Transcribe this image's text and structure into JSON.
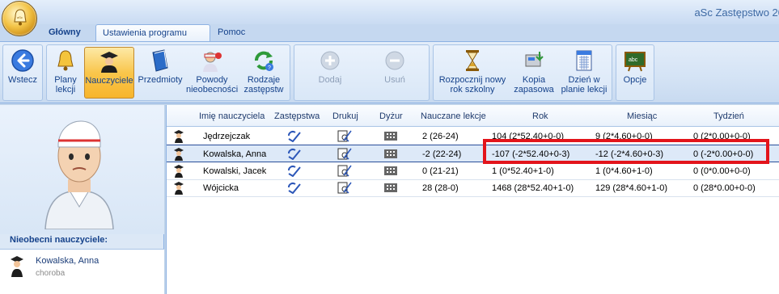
{
  "app": {
    "title": "aSc Zastępstwo 20"
  },
  "tabs": [
    {
      "label": "Główny",
      "active": false
    },
    {
      "label": "Ustawienia programu",
      "active": true
    },
    {
      "label": "Pomoc",
      "active": false
    }
  ],
  "ribbon": {
    "back": {
      "label": "Wstecz",
      "icon": "back-arrow-icon"
    },
    "group1": [
      {
        "label": "Plany\nlekcji",
        "icon": "bell-icon"
      },
      {
        "label": "Nauczyciele",
        "icon": "teacher-icon",
        "selected": true
      },
      {
        "label": "Przedmioty",
        "icon": "book-icon"
      },
      {
        "label": "Powody\nnieobecności",
        "icon": "absence-reason-icon"
      },
      {
        "label": "Rodzaje\nzastępstw",
        "icon": "substitution-types-icon"
      }
    ],
    "group2": [
      {
        "label": "Dodaj",
        "icon": "add-icon",
        "disabled": true
      },
      {
        "label": "Usuń",
        "icon": "remove-icon",
        "disabled": true
      }
    ],
    "group3": [
      {
        "label": "Rozpocznij nowy\nrok szkolny",
        "icon": "hourglass-icon"
      },
      {
        "label": "Kopia\nzapasowa",
        "icon": "backup-icon"
      },
      {
        "label": "Dzień w\nplanie lekcji",
        "icon": "calendar-icon"
      }
    ],
    "group4": [
      {
        "label": "Opcje",
        "icon": "blackboard-icon"
      }
    ]
  },
  "left_panel": {
    "absent_title": "Nieobecni nauczyciele:",
    "absent": [
      {
        "name": "Kowalska, Anna",
        "reason": "choroba"
      }
    ]
  },
  "grid": {
    "columns": [
      "Imię nauczyciela",
      "Zastępstwa",
      "Drukuj",
      "Dyżur",
      "Nauczane lekcje",
      "Rok",
      "Miesiąc",
      "Tydzień"
    ],
    "rows": [
      {
        "name": "Jędrzejczak",
        "taught": "2 (26-24)",
        "year": "104 (2*52.40+0-0)",
        "month": "9 (2*4.60+0-0)",
        "week": "0 (2*0.00+0-0)",
        "selected": false
      },
      {
        "name": "Kowalska, Anna",
        "taught": "-2 (22-24)",
        "year": "-107 (-2*52.40+0-3)",
        "month": "-12 (-2*4.60+0-3)",
        "week": "0 (-2*0.00+0-0)",
        "selected": true
      },
      {
        "name": "Kowalski, Jacek",
        "taught": "0 (21-21)",
        "year": "1 (0*52.40+1-0)",
        "month": "1 (0*4.60+1-0)",
        "week": "0 (0*0.00+0-0)",
        "selected": false
      },
      {
        "name": "Wójcicka",
        "taught": "28 (28-0)",
        "year": "1468 (28*52.40+1-0)",
        "month": "129 (28*4.60+1-0)",
        "week": "0 (28*0.00+0-0)",
        "selected": false
      }
    ]
  },
  "colors": {
    "highlight": "#e3141b",
    "ribbon": "#d4e3f5",
    "accent": "#15428b"
  }
}
